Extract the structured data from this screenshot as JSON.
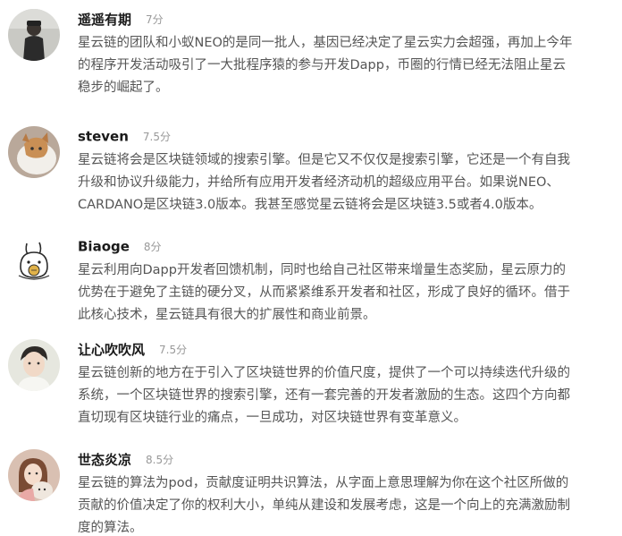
{
  "comments": [
    {
      "author": "遥遥有期",
      "score": "7分",
      "avatar_icon": "person-avatar-icon",
      "lines": [
        "星云链的团队和小蚁NEO的是同一批人，基因已经决定了星云实力会超强，再加上今年",
        "的程序开发活动吸引了一大批程序猿的参与开发Dapp，币圈的行情已经无法阻止星云",
        "稳步的崛起了。"
      ]
    },
    {
      "author": "steven",
      "score": "7.5分",
      "avatar_icon": "cat-avatar-icon",
      "lines": [
        "星云链将会是区块链领域的搜索引擎。但是它又不仅仅是搜索引擎，它还是一个有自我",
        "升级和协议升级能力，并给所有应用开发者经济动机的超级应用平台。如果说NEO、",
        "CARDANO是区块链3.0版本。我甚至感觉星云链将会是区块链3.5或者4.0版本。"
      ]
    },
    {
      "author": "Biaoge",
      "score": "8分",
      "avatar_icon": "rabbit-cartoon-avatar-icon",
      "lines": [
        "星云利用向Dapp开发者回馈机制，同时也给自己社区带来增量生态奖励，星云原力的",
        "优势在于避免了主链的硬分叉，从而紧紧维系开发者和社区，形成了良好的循环。借于",
        "此核心技术，星云链具有很大的扩展性和商业前景。"
      ]
    },
    {
      "author": "让心吹吹风",
      "score": "7.5分",
      "avatar_icon": "boy-avatar-icon",
      "lines": [
        "星云链创新的地方在于引入了区块链世界的价值尺度，提供了一个可以持续迭代升级的",
        "系统，一个区块链世界的搜索引擎，还有一套完善的开发者激励的生态。这四个方向都",
        "直切现有区块链行业的痛点，一旦成功，对区块链世界有变革意义。"
      ]
    },
    {
      "author": "世态炎凉",
      "score": "8.5分",
      "avatar_icon": "girl-with-dog-avatar-icon",
      "lines": [
        "星云链的算法为pod，贡献度证明共识算法，从字面上意思理解为你在这个社区所做的",
        "贡献的价值决定了你的权利大小，单纯从建设和发展考虑，这是一个向上的充满激励制",
        "度的算法。"
      ]
    }
  ]
}
